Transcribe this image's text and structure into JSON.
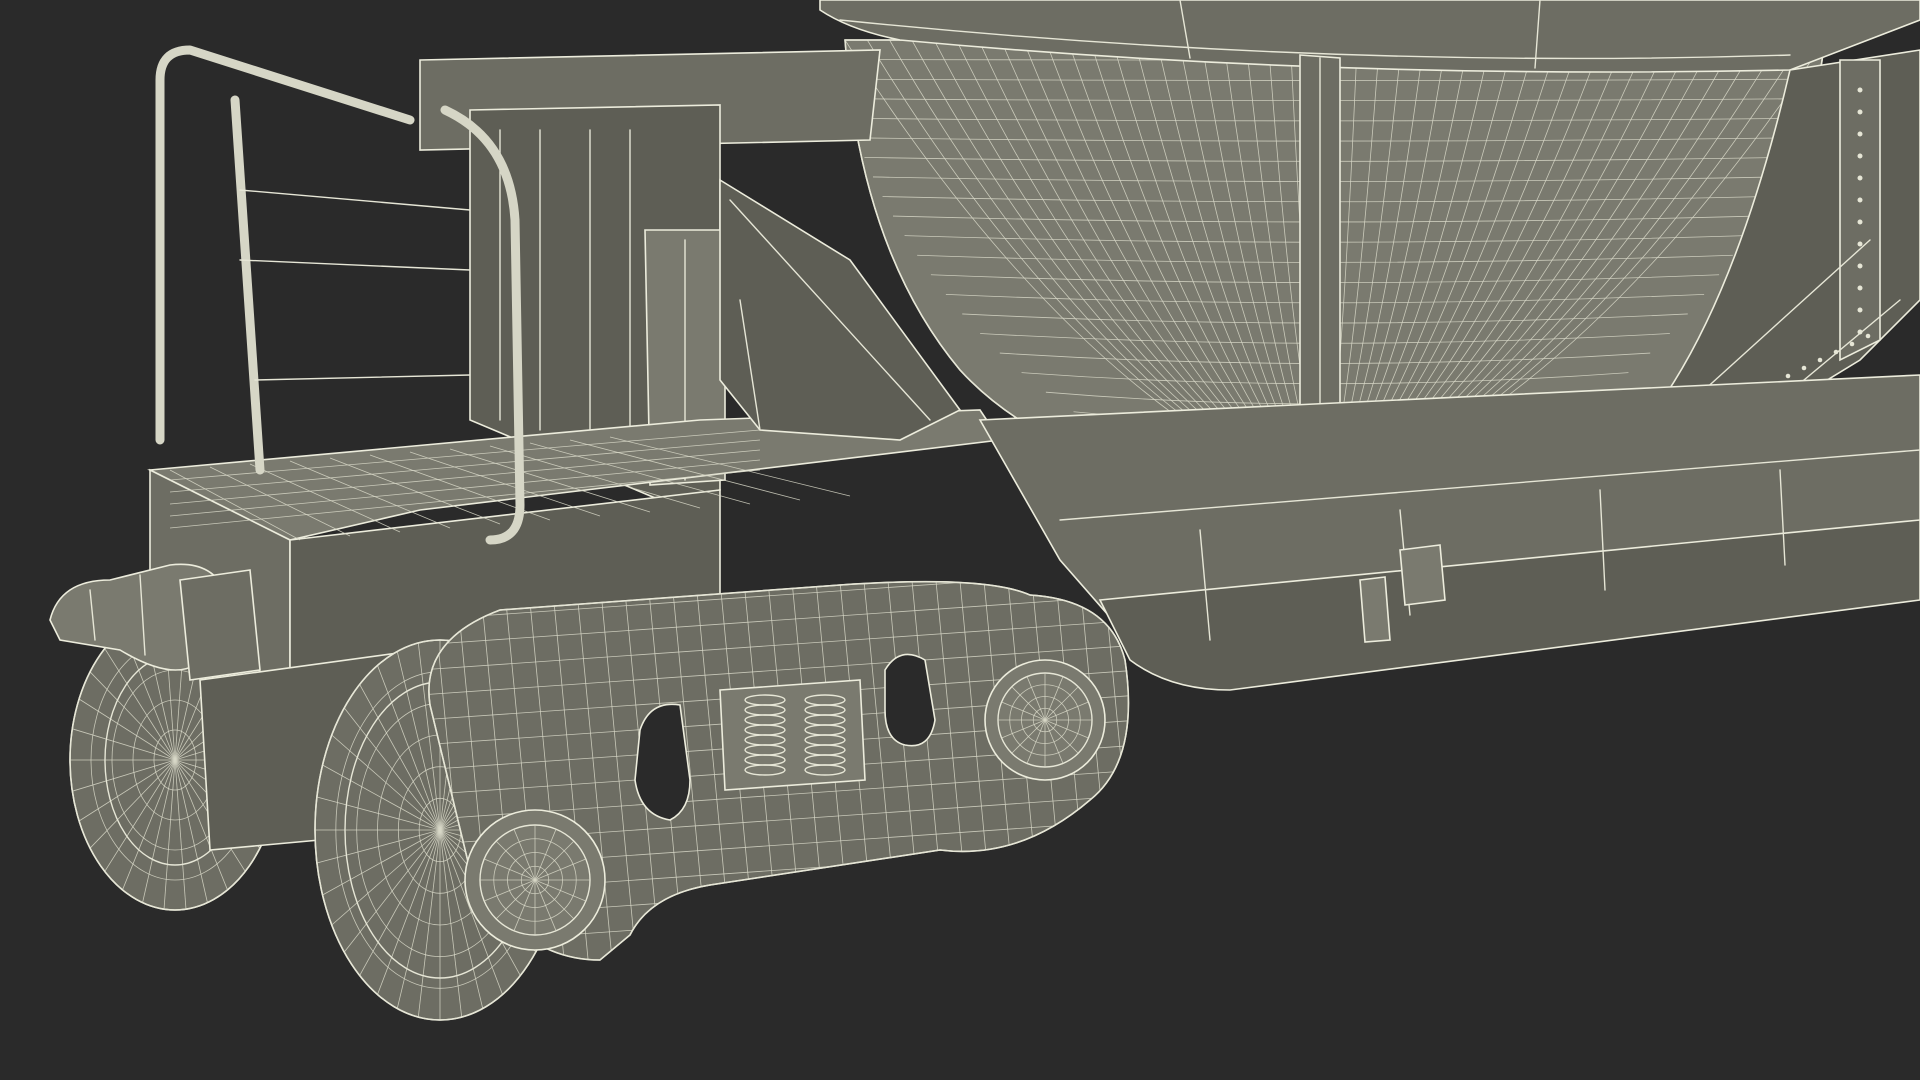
{
  "scene": {
    "background_color": "#2a2a2a",
    "model_fill_color": "#6d6d63",
    "wireframe_color": "#e6e6d6"
  }
}
